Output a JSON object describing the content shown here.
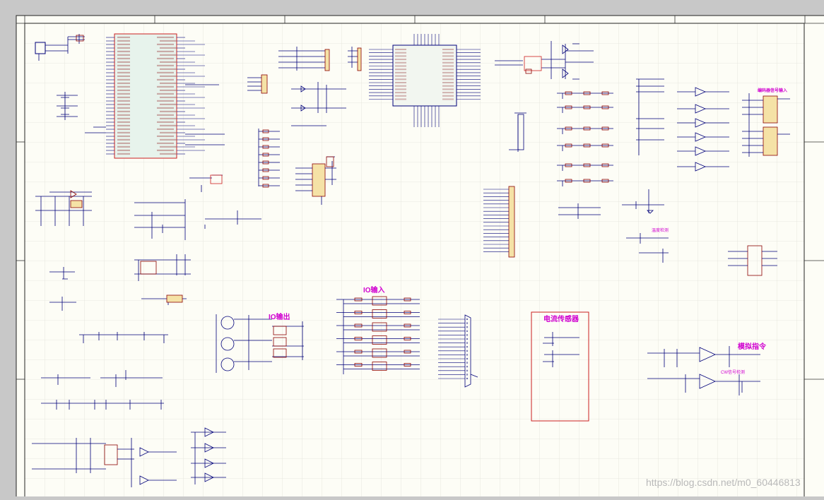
{
  "schematic": {
    "annotations": {
      "io_input": "IO输入",
      "io_output": "IO输出",
      "current_sensor": "电流传感器",
      "analog_command": "模拟指令",
      "encoder_input": "编码器信号输入",
      "cw_signal": "CW信号检测",
      "sub_note": "温度检测"
    },
    "watermark": "https://blog.csdn.net/m0_60446813"
  },
  "colors": {
    "paper": "#fdfdf6",
    "grid": "#e4e4dc",
    "wire": "#00007a",
    "component": "#8b0000",
    "ic_body": "#e7f3ec",
    "header_body": "#f5e2a6",
    "highlight": "#cc2020",
    "magenta": "#d000d0",
    "frame": "#222222"
  }
}
